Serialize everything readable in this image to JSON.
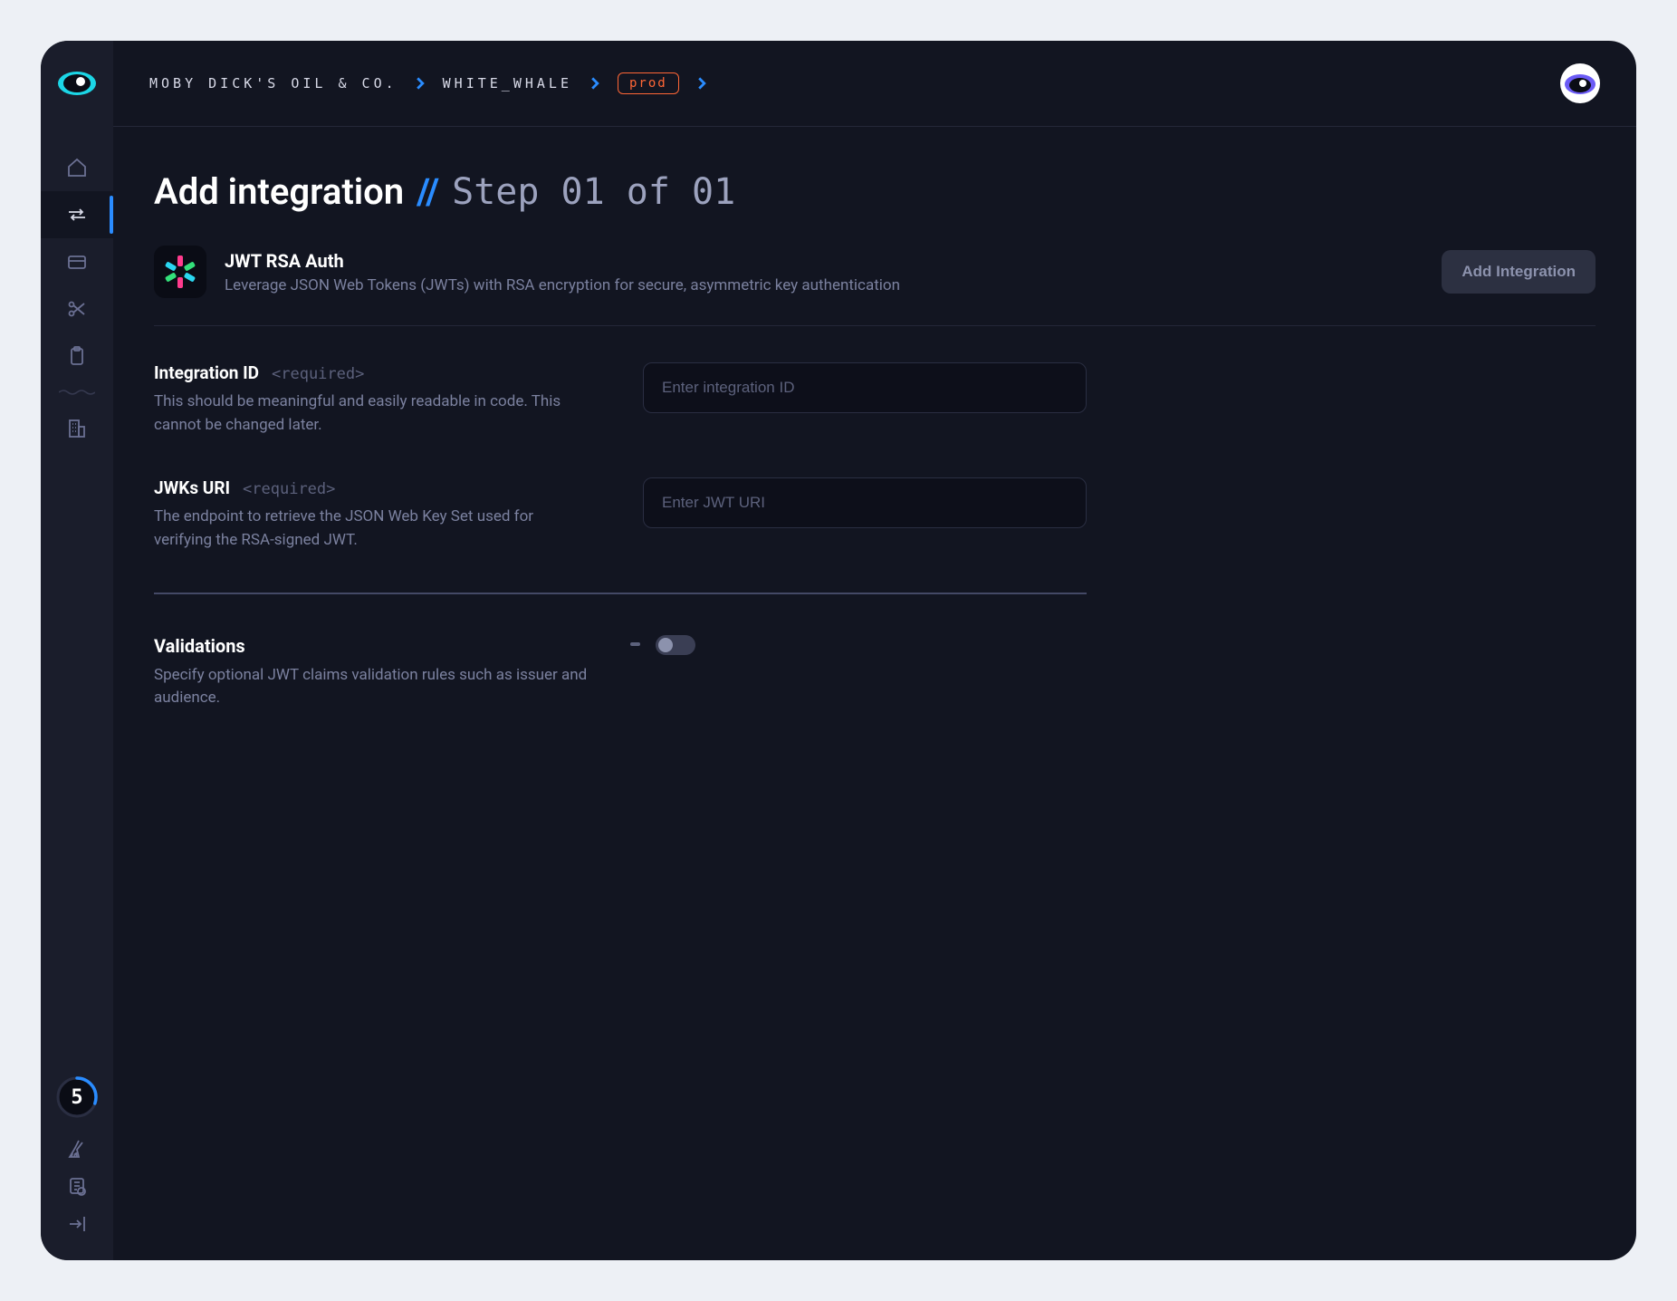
{
  "breadcrumbs": {
    "org": "MOBY DICK'S OIL & CO.",
    "project": "WHITE_WHALE",
    "env": "prod"
  },
  "page": {
    "title": "Add integration",
    "step_separator": "//",
    "step_text": "Step 01 of 01"
  },
  "integration": {
    "title": "JWT RSA Auth",
    "description": "Leverage JSON Web Tokens (JWTs) with RSA encryption for secure, asymmetric key authentication",
    "button_label": "Add Integration"
  },
  "fields": {
    "integration_id": {
      "label": "Integration ID",
      "required_tag": "<required>",
      "help": "This should be meaningful and easily readable in code. This cannot be changed later.",
      "placeholder": "Enter integration ID",
      "value": ""
    },
    "jwks_uri": {
      "label": "JWKs URI",
      "required_tag": "<required>",
      "help": "The endpoint to retrieve the JSON Web Key Set used for verifying the RSA-signed JWT.",
      "placeholder": "Enter JWT URI",
      "value": ""
    }
  },
  "validations": {
    "title": "Validations",
    "help": "Specify optional JWT claims validation rules such as issuer and audience.",
    "enabled": false
  },
  "sidebar": {
    "progress_value": "5"
  }
}
